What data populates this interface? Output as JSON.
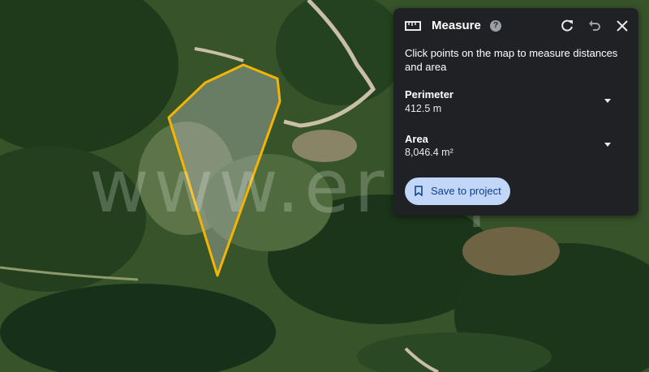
{
  "panel": {
    "title": "Measure",
    "help_icon": "?",
    "instruction": "Click points on the map to measure distances and area",
    "perimeter": {
      "label": "Perimeter",
      "value": "412.5 m"
    },
    "area": {
      "label": "Area",
      "value": "8,046.4 m²"
    },
    "save_label": "Save to project"
  },
  "watermark": "www.era.pt",
  "icons": {
    "ruler": "ruler-icon",
    "help": "help-icon",
    "reset": "reset-icon",
    "undo": "undo-icon",
    "close": "close-icon",
    "bookmark": "bookmark-icon"
  },
  "colors": {
    "polygon_stroke": "#f4b400",
    "panel_bg": "#202124",
    "save_bg": "#c2d7f7",
    "save_text": "#0b3d91"
  }
}
